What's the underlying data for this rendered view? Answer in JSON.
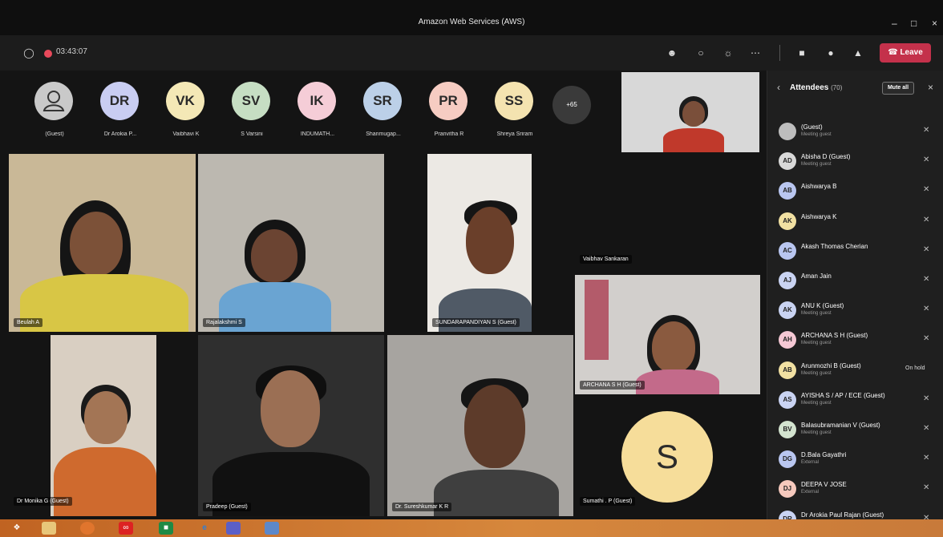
{
  "window": {
    "title": "Amazon Web Services (AWS)",
    "minimize_icon": "minimize-icon",
    "maximize_icon": "maximize-icon",
    "close_icon": "close-icon"
  },
  "toolbar": {
    "timer": "03:43:07",
    "leave_label": "Leave",
    "icons": [
      "shield-icon",
      "record-icon",
      "people-icon",
      "chat-icon",
      "reactions-icon",
      "more-icon",
      "camera-icon",
      "mic-icon",
      "share-icon",
      "phone-icon"
    ]
  },
  "avatars": [
    {
      "initials": "",
      "name": "(Guest)",
      "color": "#c9c9c9"
    },
    {
      "initials": "DR",
      "name": "Dr Arokia P...",
      "color": "#c9cdf2"
    },
    {
      "initials": "VK",
      "name": "Vaibhavi K",
      "color": "#f4e8b6"
    },
    {
      "initials": "SV",
      "name": "S Varsini",
      "color": "#c6dec3"
    },
    {
      "initials": "IK",
      "name": "INDUMATH...",
      "color": "#f5cdd7"
    },
    {
      "initials": "SR",
      "name": "Shanmugap...",
      "color": "#bcd0e8"
    },
    {
      "initials": "PR",
      "name": "Pranvitha R",
      "color": "#f6ccc2"
    },
    {
      "initials": "SS",
      "name": "Shreya Sriram",
      "color": "#f4e3b0"
    }
  ],
  "more_participants": "+65",
  "tiles": [
    {
      "name": "Beulah A"
    },
    {
      "name": "Rajalakshmi S"
    },
    {
      "name": "SUNDARAPANDIYAN S (Guest)"
    },
    {
      "name": "Vaibhav Sankaran"
    },
    {
      "name": "ARCHANA S H (Guest)"
    },
    {
      "name": "Dr Monika G (Guest)"
    },
    {
      "name": "Pradeep (Guest)"
    },
    {
      "name": "Dr. Sureshkumar K R"
    },
    {
      "name": "Sumathi . P (Guest)"
    }
  ],
  "s_avatar_initial": "S",
  "panel": {
    "title": "Attendees",
    "count": "(70)",
    "mute_all": "Mute all",
    "attendees": [
      {
        "initials": "",
        "name": "(Guest)",
        "sub": "Meeting guest",
        "color": "#bdbdbd",
        "status": ""
      },
      {
        "initials": "AD",
        "name": "Abisha D (Guest)",
        "sub": "Meeting guest",
        "color": "#d8d8d8",
        "status": ""
      },
      {
        "initials": "AB",
        "name": "Aishwarya B",
        "sub": "",
        "color": "#b9c6f0",
        "status": ""
      },
      {
        "initials": "AK",
        "name": "Aishwarya K",
        "sub": "",
        "color": "#f1e0a2",
        "status": ""
      },
      {
        "initials": "AC",
        "name": "Akash Thomas Cherian",
        "sub": "",
        "color": "#b9c6f0",
        "status": ""
      },
      {
        "initials": "AJ",
        "name": "Aman Jain",
        "sub": "",
        "color": "#c9d3f2",
        "status": ""
      },
      {
        "initials": "AK",
        "name": "ANU K (Guest)",
        "sub": "Meeting guest",
        "color": "#c9d3f2",
        "status": ""
      },
      {
        "initials": "AH",
        "name": "ARCHANA S H (Guest)",
        "sub": "Meeting guest",
        "color": "#f5c8d4",
        "status": ""
      },
      {
        "initials": "AB",
        "name": "Arunmozhi B (Guest)",
        "sub": "Meeting guest",
        "color": "#f1e0a2",
        "status": "On hold"
      },
      {
        "initials": "AS",
        "name": "AYISHA S / AP / ECE (Guest)",
        "sub": "Meeting guest",
        "color": "#c9d3f2",
        "status": ""
      },
      {
        "initials": "BV",
        "name": "Balasubramanian V (Guest)",
        "sub": "Meeting guest",
        "color": "#d3e3cf",
        "status": ""
      },
      {
        "initials": "DG",
        "name": "D.Bala Gayathri",
        "sub": "External",
        "color": "#b9c6f0",
        "status": ""
      },
      {
        "initials": "DJ",
        "name": "DEEPA V JOSE",
        "sub": "External",
        "color": "#f6c9bd",
        "status": ""
      },
      {
        "initials": "DR",
        "name": "Dr Arokia Paul Rajan (Guest)",
        "sub": "",
        "color": "#c9d3f2",
        "status": ""
      }
    ]
  },
  "taskbar": {
    "icons": [
      "windows-start-icon",
      "file-explorer-icon",
      "firefox-icon",
      "acrobat-icon",
      "excel-icon",
      "internet-explorer-icon",
      "teams-icon",
      "photos-icon"
    ]
  }
}
